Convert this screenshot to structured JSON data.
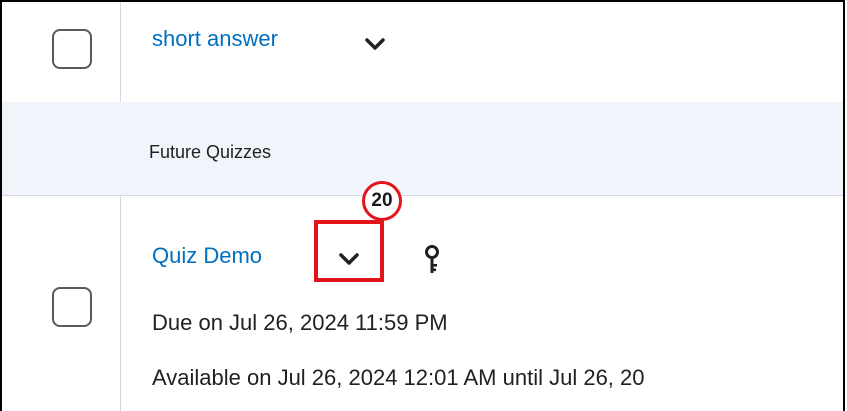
{
  "quizzes": {
    "row1": {
      "title": "short answer"
    },
    "section": {
      "title": "Future Quizzes"
    },
    "row2": {
      "title": "Quiz Demo",
      "due": "Due on Jul 26, 2024 11:59 PM",
      "availability": "Available on Jul 26, 2024 12:01 AM until Jul 26, 20"
    }
  },
  "annotation": {
    "step_number": "20",
    "color": "#e2141c"
  },
  "colors": {
    "link": "#006fbf",
    "section_bg": "#f1f5fb",
    "divider": "#d3d9e3"
  },
  "icons": {
    "context_menu": "chevron-down-icon",
    "restriction": "key-icon"
  }
}
